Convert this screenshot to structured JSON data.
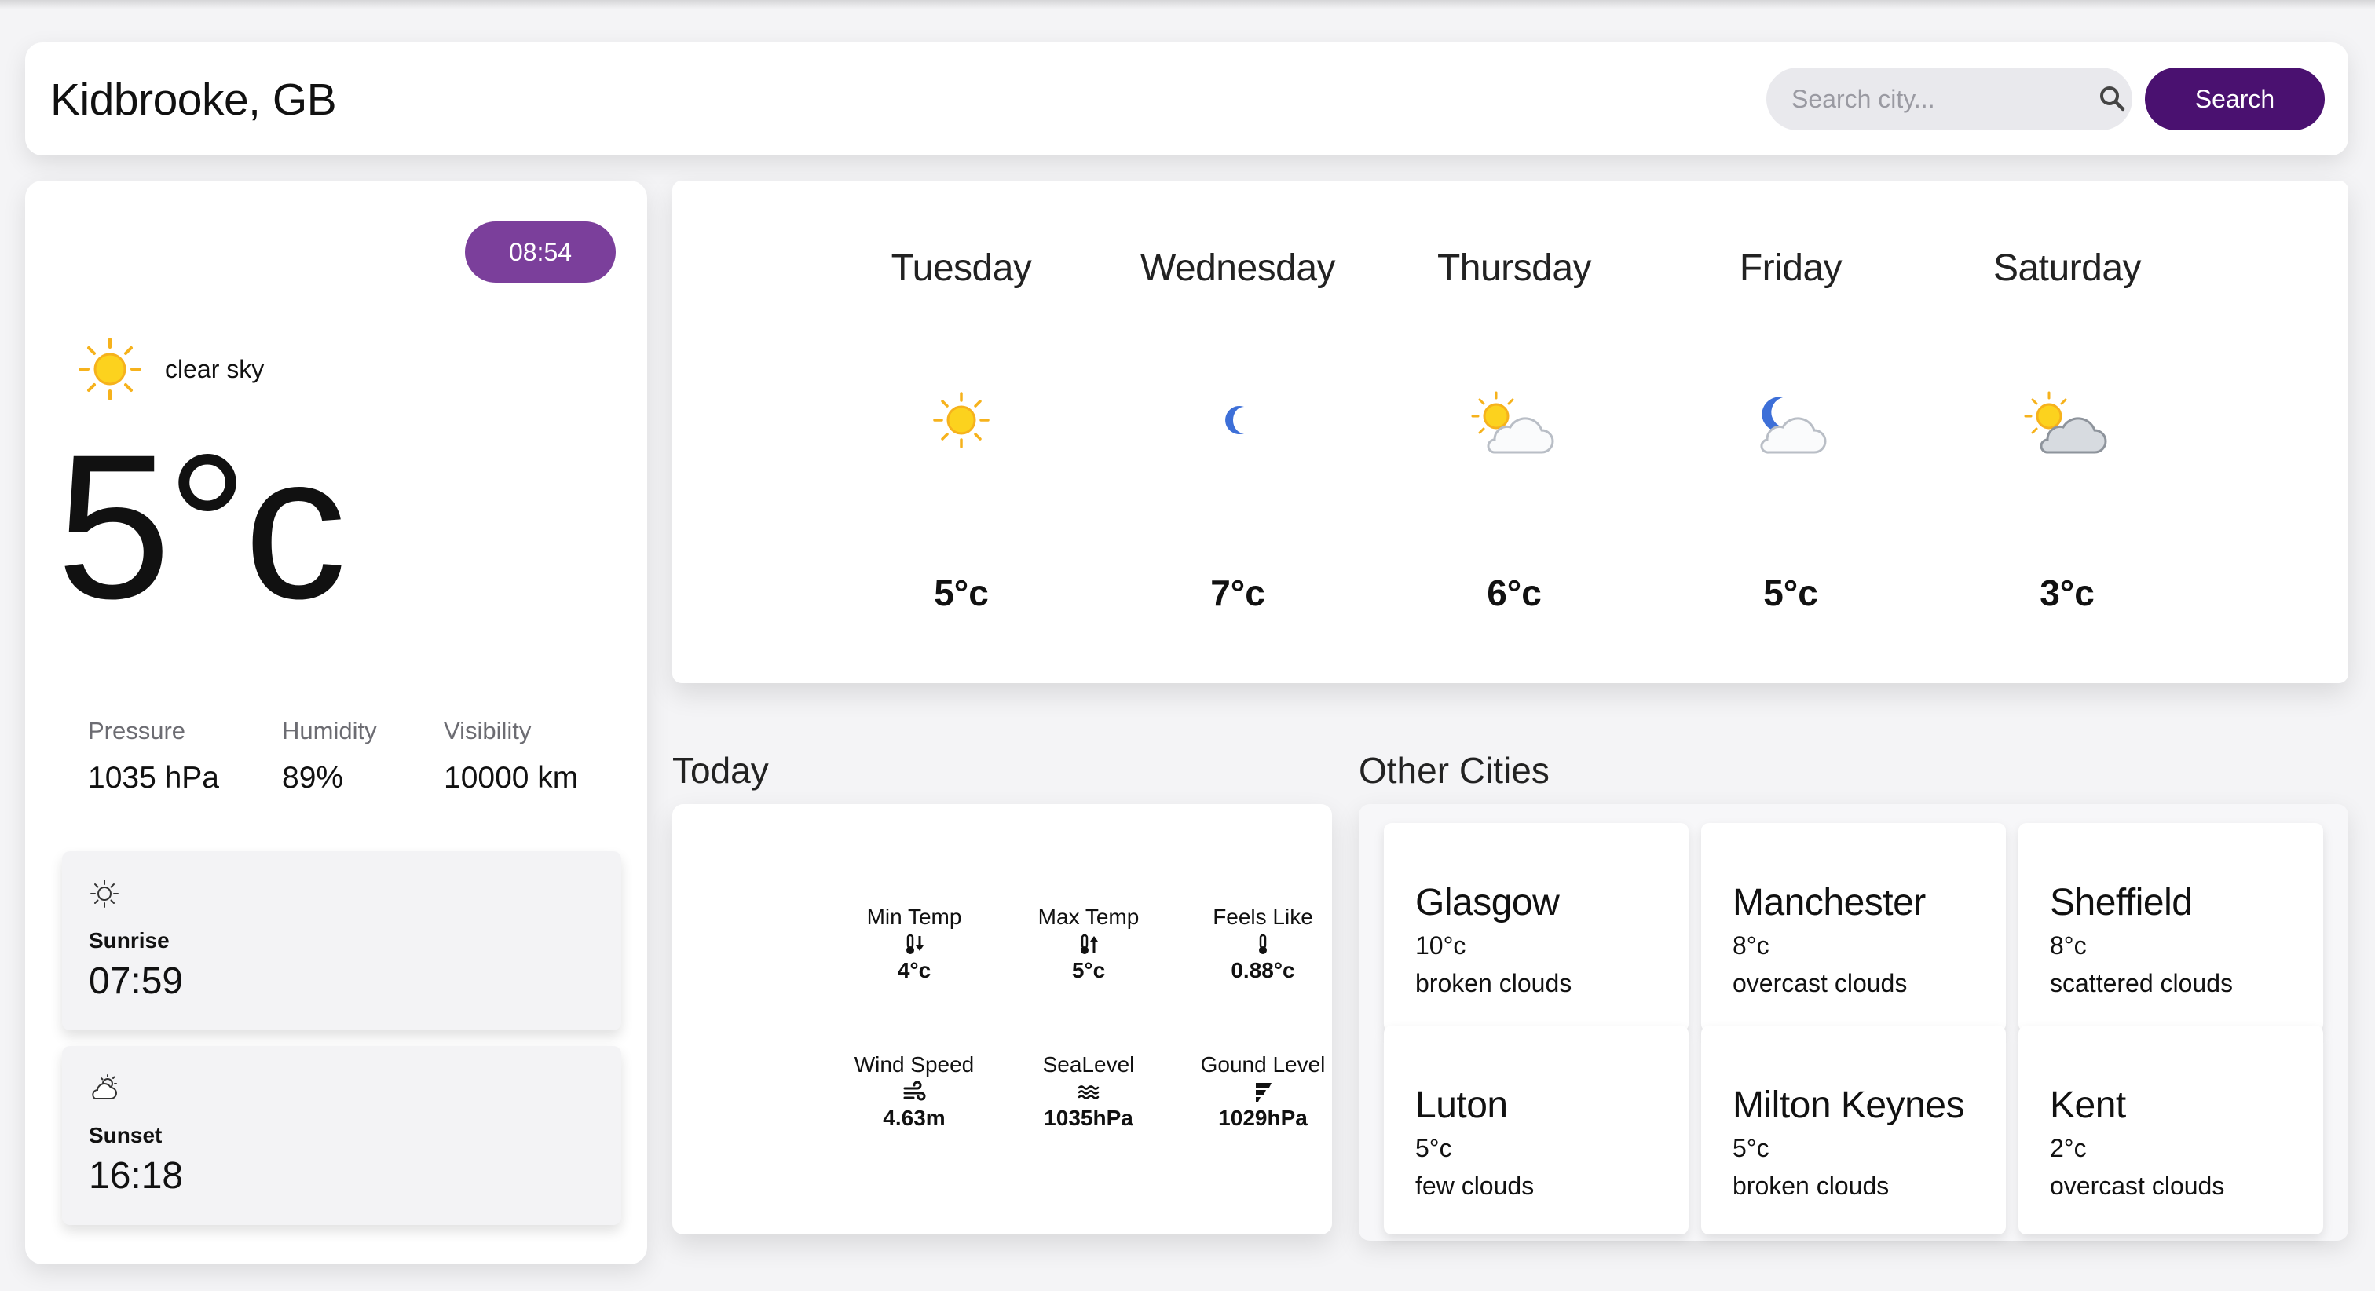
{
  "header": {
    "location": "Kidbrooke, GB",
    "search_placeholder": "Search city...",
    "search_label": "Search"
  },
  "current": {
    "time": "08:54",
    "description": "clear sky",
    "temperature": "5°c",
    "stats": [
      {
        "label": "Pressure",
        "value": "1035 hPa"
      },
      {
        "label": "Humidity",
        "value": "89%"
      },
      {
        "label": "Visibility",
        "value": "10000 km"
      }
    ],
    "sunrise": {
      "label": "Sunrise",
      "time": "07:59"
    },
    "sunset": {
      "label": "Sunset",
      "time": "16:18"
    }
  },
  "forecast": [
    {
      "day": "Tuesday",
      "temp": "5°c",
      "icon": "sun-icon"
    },
    {
      "day": "Wednesday",
      "temp": "7°c",
      "icon": "moon-icon"
    },
    {
      "day": "Thursday",
      "temp": "6°c",
      "icon": "sun-cloud-icon"
    },
    {
      "day": "Friday",
      "temp": "5°c",
      "icon": "moon-cloud-icon"
    },
    {
      "day": "Saturday",
      "temp": "3°c",
      "icon": "sun-cloud-icon"
    }
  ],
  "today": {
    "title": "Today",
    "metrics": [
      {
        "label": "Min Temp",
        "value": "4°c",
        "icon": "thermometer-down-icon"
      },
      {
        "label": "Max Temp",
        "value": "5°c",
        "icon": "thermometer-up-icon"
      },
      {
        "label": "Feels Like",
        "value": "0.88°c",
        "icon": "thermometer-icon"
      },
      {
        "label": "Wind Speed",
        "value": "4.63m",
        "icon": "wind-icon"
      },
      {
        "label": "SeaLevel",
        "value": "1035hPa",
        "icon": "waves-icon"
      },
      {
        "label": "Gound Level",
        "value": "1029hPa",
        "icon": "ground-icon"
      }
    ]
  },
  "other_cities": {
    "title": "Other Cities",
    "cities": [
      {
        "name": "Glasgow",
        "temp": "10°c",
        "desc": "broken clouds"
      },
      {
        "name": "Manchester",
        "temp": "8°c",
        "desc": "overcast clouds"
      },
      {
        "name": "Sheffield",
        "temp": "8°c",
        "desc": "scattered clouds"
      },
      {
        "name": "Luton",
        "temp": "5°c",
        "desc": "few clouds"
      },
      {
        "name": "Milton Keynes",
        "temp": "5°c",
        "desc": "broken clouds"
      },
      {
        "name": "Kent",
        "temp": "2°c",
        "desc": "overcast clouds"
      }
    ]
  },
  "colors": {
    "accent": "#4a1170",
    "time_pill": "#7b3f9b",
    "sun": "#f6c21c",
    "moon": "#3d6fd8"
  }
}
